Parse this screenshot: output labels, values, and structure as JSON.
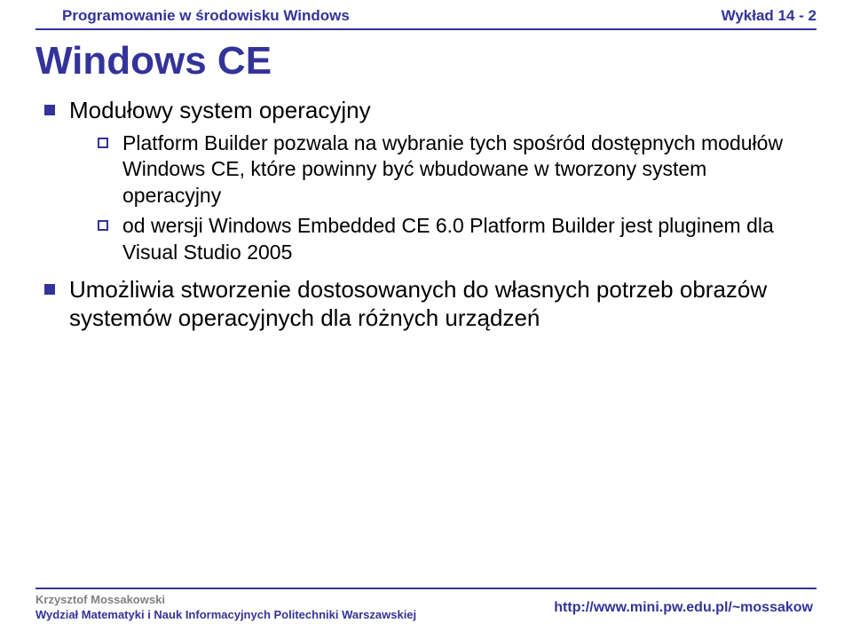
{
  "header": {
    "left": "Programowanie w środowisku Windows",
    "right": "Wykład 14 - 2"
  },
  "title": "Windows CE",
  "bullets": [
    {
      "text": "Modułowy system operacyjny",
      "subs": [
        "Platform Builder pozwala na wybranie tych spośród dostępnych modułów Windows CE, które powinny być wbudowane w tworzony system operacyjny",
        "od wersji Windows Embedded CE 6.0 Platform Builder jest pluginem dla Visual Studio 2005"
      ]
    },
    {
      "text": "Umożliwia stworzenie dostosowanych do własnych potrzeb obrazów systemów operacyjnych dla różnych urządzeń",
      "subs": []
    }
  ],
  "footer": {
    "author": "Krzysztof Mossakowski",
    "department": "Wydział Matematyki i Nauk Informacyjnych Politechniki Warszawskiej",
    "url": "http://www.mini.pw.edu.pl/~mossakow"
  }
}
